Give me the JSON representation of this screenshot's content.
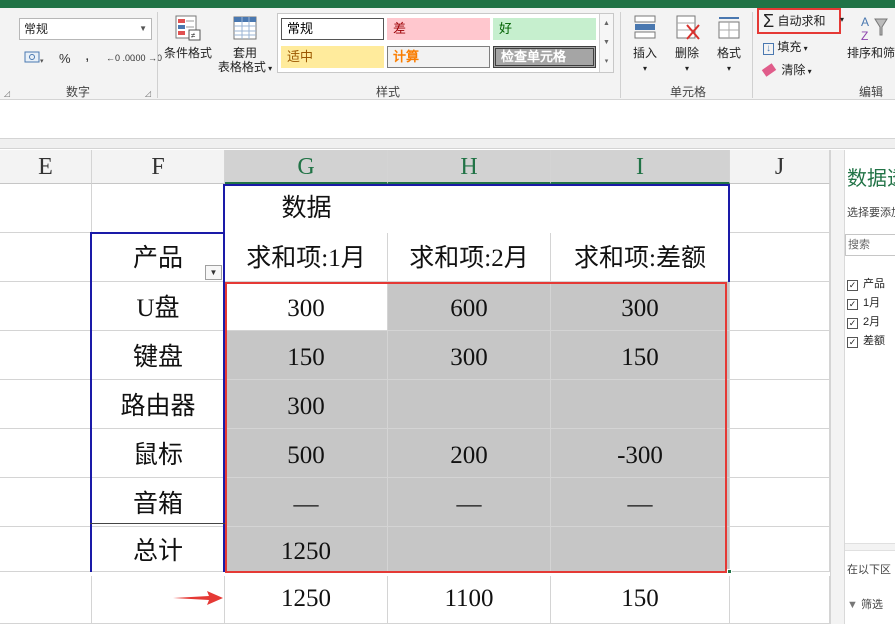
{
  "ribbon": {
    "number_format": "常规",
    "percent": "%",
    "comma": ",",
    "decimal_increase": "←0 .00",
    "decimal_decrease": ".00 →0",
    "number_group": "数字",
    "conditional_format": "条件格式",
    "format_as_table_1": "套用",
    "format_as_table_2": "表格格式",
    "styles": [
      "常规",
      "差",
      "好",
      "适中",
      "计算",
      "检查单元格"
    ],
    "styles_group": "样式",
    "insert": "插入",
    "delete": "删除",
    "format": "格式",
    "cells_group": "单元格",
    "autosum": "自动求和",
    "fill": "填充",
    "clear": "清除",
    "sort_filter": "排序和筛",
    "editing_group": "编辑"
  },
  "grid": {
    "columns": [
      "E",
      "F",
      "G",
      "H",
      "I",
      "J"
    ],
    "selected_columns": [
      "G",
      "H",
      "I"
    ],
    "header_label": "数据",
    "product_header": "产品",
    "value_headers": [
      "求和项:1月",
      "求和项:2月",
      "求和项:差额"
    ],
    "rows": [
      {
        "product": "U盘",
        "values": [
          "300",
          "600",
          "300"
        ]
      },
      {
        "product": "键盘",
        "values": [
          "150",
          "300",
          "150"
        ]
      },
      {
        "product": "路由器",
        "values": [
          "300",
          "",
          ""
        ]
      },
      {
        "product": "鼠标",
        "values": [
          "500",
          "200",
          "-300"
        ]
      },
      {
        "product": "音箱",
        "values": [
          "—",
          "—",
          "—"
        ]
      },
      {
        "product": "总计",
        "values": [
          "1250",
          "",
          ""
        ]
      }
    ],
    "result_row": [
      "1250",
      "1100",
      "150"
    ]
  },
  "task_pane": {
    "title": "数据透",
    "subtitle": "选择要添加",
    "search_placeholder": "搜索",
    "fields": [
      "产品",
      "1月",
      "2月",
      "差额"
    ],
    "drag_text": "在以下区",
    "filters": "筛选"
  },
  "colors": {
    "excel_green": "#217346",
    "highlight_red": "#e53935",
    "pivot_border_blue": "#1a1aa8",
    "selection_gray": "#c6c6c6"
  }
}
